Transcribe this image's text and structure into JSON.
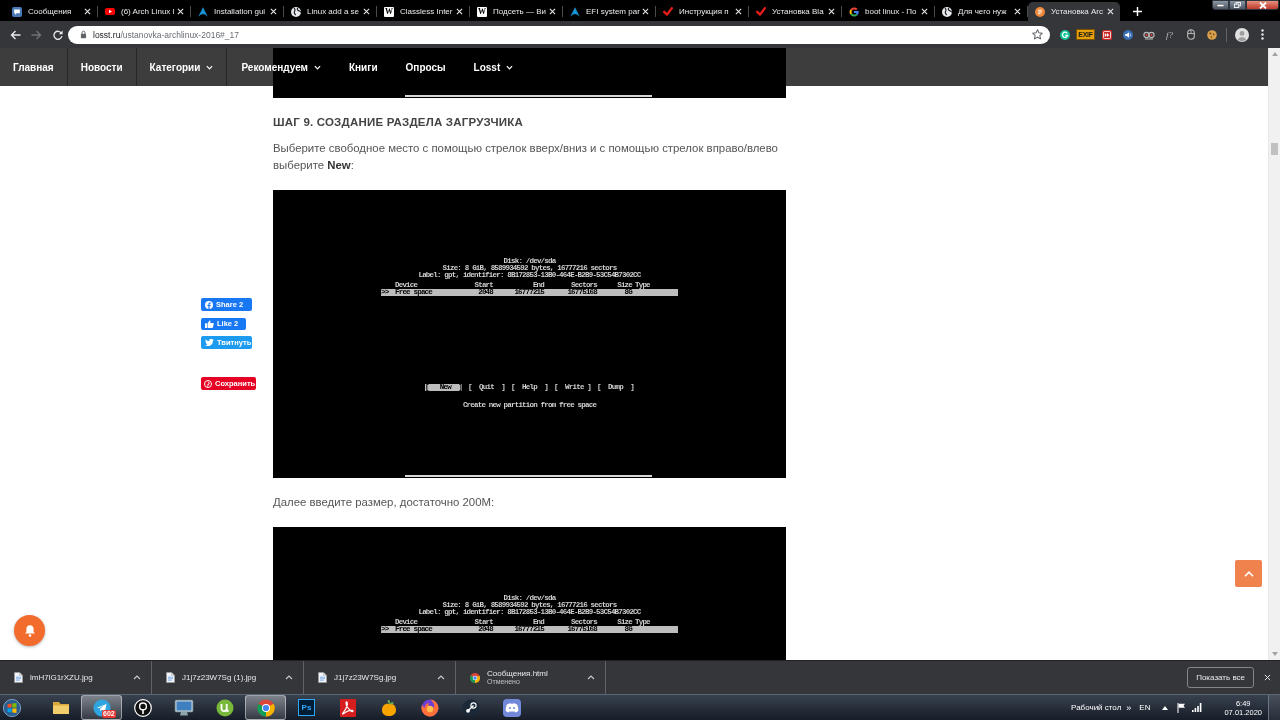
{
  "browser": {
    "tabs": [
      {
        "title": "Сообщения",
        "selected": false
      },
      {
        "title": "(6) Arch Linux I",
        "selected": false
      },
      {
        "title": "Installation gui",
        "selected": false
      },
      {
        "title": "Linux add a se",
        "selected": false
      },
      {
        "title": "Classless Inter",
        "selected": false,
        "favicon_letter": "W"
      },
      {
        "title": "Подсеть — Ви",
        "selected": false,
        "favicon_letter": "W"
      },
      {
        "title": "EFI system par",
        "selected": false
      },
      {
        "title": "Инструкция п",
        "selected": false
      },
      {
        "title": "Установка Bla",
        "selected": false
      },
      {
        "title": "boot linux - По",
        "selected": false
      },
      {
        "title": "Для чего нуж",
        "selected": false
      },
      {
        "title": "Установка Arc",
        "selected": true
      }
    ],
    "navigation": {
      "back_disabled": false,
      "forward_disabled": true
    },
    "address": {
      "host": "losst.ru",
      "path": "/ustanovka-archlinux-2016#_17"
    },
    "extension_labels": [
      "EXIF",
      "f?"
    ]
  },
  "nav": [
    {
      "label": "Главная",
      "dropdown": false
    },
    {
      "label": "Новости",
      "dropdown": false
    },
    {
      "label": "Категории",
      "dropdown": true
    },
    {
      "label": "Рекомендуем",
      "dropdown": true
    },
    {
      "label": "Книги",
      "dropdown": false
    },
    {
      "label": "Опросы",
      "dropdown": false
    },
    {
      "label": "Losst",
      "dropdown": true
    }
  ],
  "content": [
    {
      "kind": "image"
    },
    {
      "kind": "heading",
      "text": "ШАГ 9. СОЗДАНИЕ РАЗДЕЛА ЗАГРУЗЧИКА"
    },
    {
      "kind": "paragraph",
      "text": "Выберите свободное место с помощью стрелок вверх/вниз и с помощью стрелок вправо/влево выберите **New**:"
    },
    {
      "kind": "terminal",
      "lines": [
        "Disk: /dev/sda",
        "Size: 8 GiB, 8589934592 bytes, 16777216 sectors",
        "Label: gpt, identifier: 8B172853-13B0-464E-B2B9-53C54B7302CC"
      ],
      "columns": [
        "Device",
        "Start",
        "End",
        "Sectors",
        "Size",
        "Type"
      ],
      "rows": [
        {
          "selected": true,
          "marker": ">>",
          "cells": [
            "Free space",
            "2048",
            "16777215",
            "16775168",
            "8G"
          ]
        }
      ],
      "buttons": [
        {
          "label": "[   New  ]",
          "selected": true
        },
        {
          "label": "[  Quit  ]",
          "selected": false
        },
        {
          "label": "[  Help  ]",
          "selected": false
        },
        {
          "label": "[  Write ]",
          "selected": false
        },
        {
          "label": "[  Dump  ]",
          "selected": false
        }
      ],
      "hint": "Create new partition from free space"
    },
    {
      "kind": "paragraph",
      "text": "Далее введите размер, достаточно 200M:"
    },
    {
      "kind": "terminal",
      "lines": [
        "Disk: /dev/sda",
        "Size: 8 GiB, 8589934592 bytes, 16777216 sectors",
        "Label: gpt, identifier: 8B172853-13B0-464E-B2B9-53C54B7302CC"
      ],
      "columns": [
        "Device",
        "Start",
        "End",
        "Sectors",
        "Size",
        "Type"
      ],
      "rows": [
        {
          "selected": true,
          "marker": ">>",
          "cells": [
            "Free space",
            "2048",
            "16777215",
            "16775168",
            "8G"
          ]
        }
      ]
    }
  ],
  "share_buttons": [
    {
      "kind": "share",
      "label": "Share 2"
    },
    {
      "kind": "like",
      "label": "Like 2"
    },
    {
      "kind": "tweet",
      "label": "Твитнуть"
    },
    {
      "kind": "pin",
      "label": "Сохранить"
    }
  ],
  "downloads": {
    "items": [
      {
        "name": "lmH7lG1rXZU.jpg"
      },
      {
        "name": "J1j7z23W7Sg (1).jpg"
      },
      {
        "name": "J1j7z23W7Sg.jpg"
      },
      {
        "name": "Сообщения.html",
        "status": "Отменено"
      }
    ],
    "show_all": "Показать все"
  },
  "taskbar": {
    "apps": [
      {
        "selected": false
      },
      {
        "selected": true,
        "badge": "602"
      },
      {
        "selected": false
      },
      {
        "selected": false
      },
      {
        "selected": false
      },
      {
        "selected": true
      },
      {
        "selected": false,
        "label": "Ps"
      },
      {
        "selected": false
      },
      {
        "selected": false
      },
      {
        "selected": false
      },
      {
        "selected": false
      },
      {
        "selected": false
      }
    ],
    "desktop_label": "Рабочий стол",
    "chevron": "»",
    "language": "EN",
    "time": "6:49",
    "date": "07.01.2020"
  }
}
